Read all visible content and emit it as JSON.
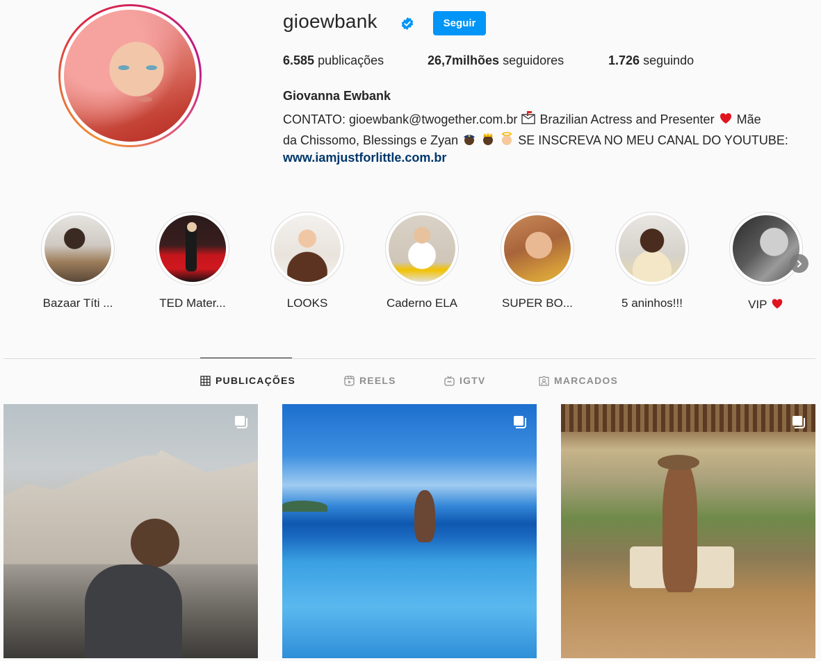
{
  "profile": {
    "username": "gioewbank",
    "verified": true,
    "follow_label": "Seguir",
    "stats": {
      "posts_count": "6.585",
      "posts_label": "publicações",
      "followers_count": "26,7milhões",
      "followers_label": "seguidores",
      "following_count": "1.726",
      "following_label": "seguindo"
    },
    "full_name": "Giovanna Ewbank",
    "bio_line1_a": "CONTATO: gioewbank@twogether.com.br",
    "bio_line1_b": "Brazilian Actress and Presenter",
    "bio_line1_c": "Mãe",
    "bio_line2_a": "da Chissomo, Blessings e Zyan",
    "bio_line2_b": "SE INSCREVA NO MEU CANAL DO YOUTUBE:",
    "link": "www.iamjustforlittle.com.br"
  },
  "highlights": [
    {
      "label": "Bazaar Títi ..."
    },
    {
      "label": "TED Mater..."
    },
    {
      "label": "LOOKS"
    },
    {
      "label": "Caderno ELA"
    },
    {
      "label": "SUPER BO..."
    },
    {
      "label": "5 aninhos!!!"
    },
    {
      "label": "VIP"
    }
  ],
  "tabs": [
    {
      "label": "PUBLICAÇÕES",
      "icon": "grid-icon",
      "active": true
    },
    {
      "label": "REELS",
      "icon": "reels-icon",
      "active": false
    },
    {
      "label": "IGTV",
      "icon": "igtv-icon",
      "active": false
    },
    {
      "label": "MARCADOS",
      "icon": "tagged-icon",
      "active": false
    }
  ],
  "colors": {
    "accent": "#0095f6",
    "link": "#00376b",
    "text": "#262626",
    "muted": "#8e8e8e",
    "background": "#fafafa"
  }
}
